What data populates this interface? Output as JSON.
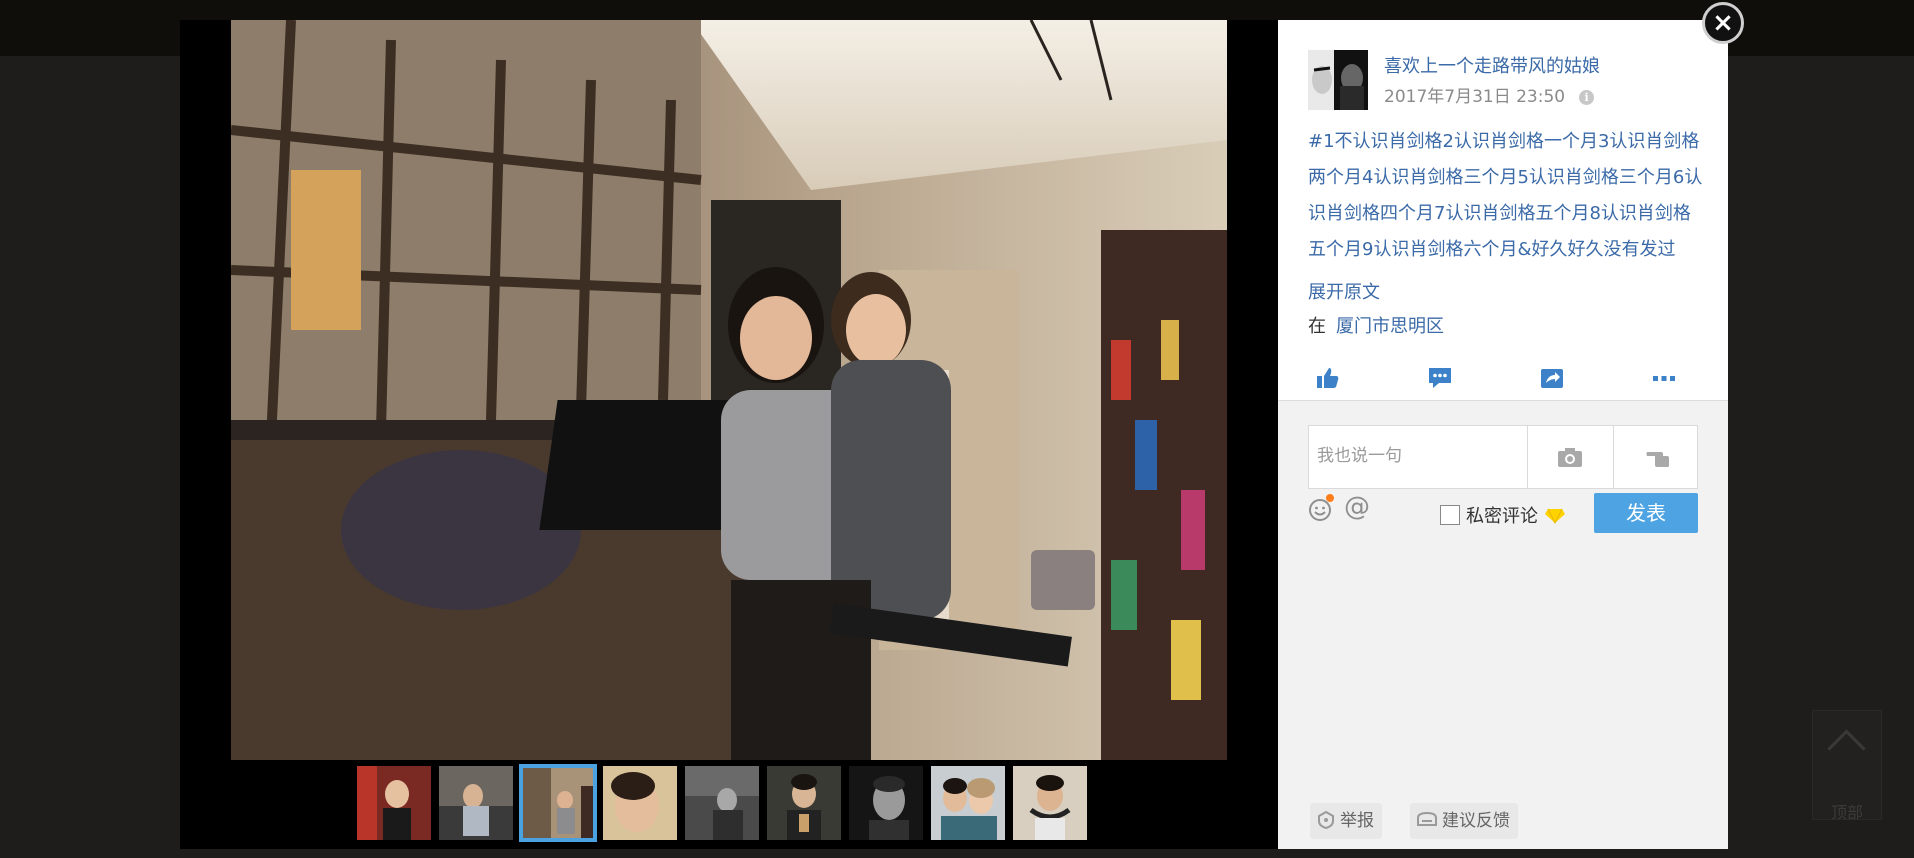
{
  "post": {
    "username": "喜欢上一个走路带风的姑娘",
    "date": "2017年7月31日 23:50",
    "text": "#1不认识肖剑格2认识肖剑格一个月3认识肖剑格两个月4认识肖剑格三个月5认识肖剑格三个月6认识肖剑格四个月7认识肖剑格五个月8认识肖剑格五个月9认识肖剑格六个月&好久好久没有发过",
    "expand_label": "展开原文",
    "location_prefix": "在",
    "location": "厦门市思明区"
  },
  "actions": [
    "like-icon",
    "comment-icon",
    "share-icon",
    "more-icon"
  ],
  "comment": {
    "placeholder": "我也说一句",
    "private_label": "私密评论",
    "send_label": "发表"
  },
  "footer": {
    "report_label": "举报",
    "feedback_label": "建议反馈"
  },
  "scroll_top_label": "顶部",
  "thumbnails": {
    "count": 9,
    "selected_index": 2
  },
  "colors": {
    "link": "#3b6aa8",
    "accent": "#4ea3e3",
    "selected_thumb": "#4aa3e0"
  }
}
